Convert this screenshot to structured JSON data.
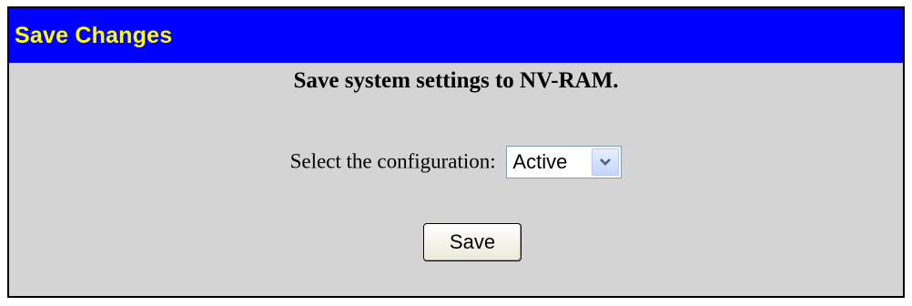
{
  "header": {
    "title": "Save Changes"
  },
  "main": {
    "heading": "Save system settings to NV-RAM.",
    "config_label": "Select the configuration:",
    "config_select": {
      "value": "Active"
    },
    "save_label": "Save"
  },
  "colors": {
    "title_bar": "#0000ff",
    "title_text": "#ffff00",
    "panel_background": "#d4d4d4"
  },
  "icons": {
    "dropdown": "chevron-down-icon"
  }
}
